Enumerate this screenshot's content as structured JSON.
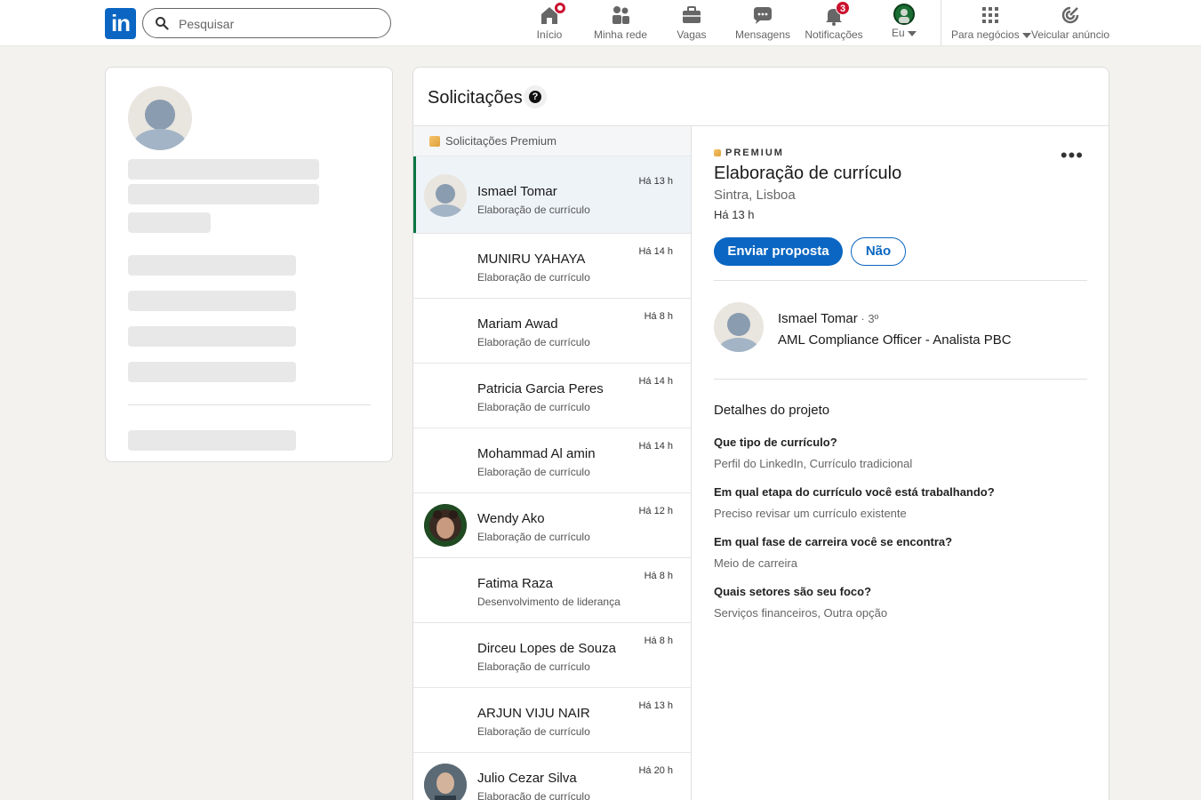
{
  "nav": {
    "search_placeholder": "Pesquisar",
    "items": [
      {
        "label": "Início",
        "badge": ""
      },
      {
        "label": "Minha rede"
      },
      {
        "label": "Vagas"
      },
      {
        "label": "Mensagens"
      },
      {
        "label": "Notificações",
        "badge": "3"
      },
      {
        "label": "Eu"
      },
      {
        "label": "Para negócios"
      },
      {
        "label": "Veicular anúncio"
      }
    ],
    "logo": "in"
  },
  "requests": {
    "title": "Solicitações",
    "list_header": "Solicitações Premium",
    "items": [
      {
        "name": "Ismael Tomar",
        "service": "Elaboração de currículo",
        "time": "Há 13 h"
      },
      {
        "name": "MUNIRU YAHAYA",
        "service": "Elaboração de currículo",
        "time": "Há 14 h"
      },
      {
        "name": "Mariam Awad",
        "service": "Elaboração de currículo",
        "time": "Há 8 h"
      },
      {
        "name": "Patricia Garcia Peres",
        "service": "Elaboração de currículo",
        "time": "Há 14 h"
      },
      {
        "name": "Mohammad Al amin",
        "service": "Elaboração de currículo",
        "time": "Há 14 h"
      },
      {
        "name": "Wendy Ako",
        "service": "Elaboração de currículo",
        "time": "Há 12 h"
      },
      {
        "name": "Fatima Raza",
        "service": "Desenvolvimento de liderança",
        "time": "Há 8 h"
      },
      {
        "name": "Dirceu Lopes de Souza",
        "service": "Elaboração de currículo",
        "time": "Há 8 h"
      },
      {
        "name": "ARJUN VIJU NAIR",
        "service": "Elaboração de currículo",
        "time": "Há 13 h"
      },
      {
        "name": "Julio Cezar Silva",
        "service": "Elaboração de currículo",
        "time": "Há 20 h"
      }
    ]
  },
  "detail": {
    "premium_label": "PREMIUM",
    "more": "•••",
    "title": "Elaboração de currículo",
    "location": "Sintra, Lisboa",
    "time": "Há 13 h",
    "send_button": "Enviar proposta",
    "decline_button": "Não",
    "person_name": "Ismael Tomar",
    "person_degree": " · 3º",
    "person_title": "AML Compliance Officer - Analista PBC",
    "project_heading": "Detalhes do projeto",
    "qa": [
      {
        "q": "Que tipo de currículo?",
        "a": "Perfil do LinkedIn, Currículo tradicional"
      },
      {
        "q": "Em qual etapa do currículo você está trabalhando?",
        "a": "Preciso revisar um currículo existente"
      },
      {
        "q": "Em qual fase de carreira você se encontra?",
        "a": "Meio de carreira"
      },
      {
        "q": "Quais setores são seu foco?",
        "a": "Serviços financeiros, Outra opção"
      }
    ]
  },
  "colors": {
    "accent": "#0a66c2",
    "active_bar": "#057642",
    "badge": "#cb112d"
  }
}
